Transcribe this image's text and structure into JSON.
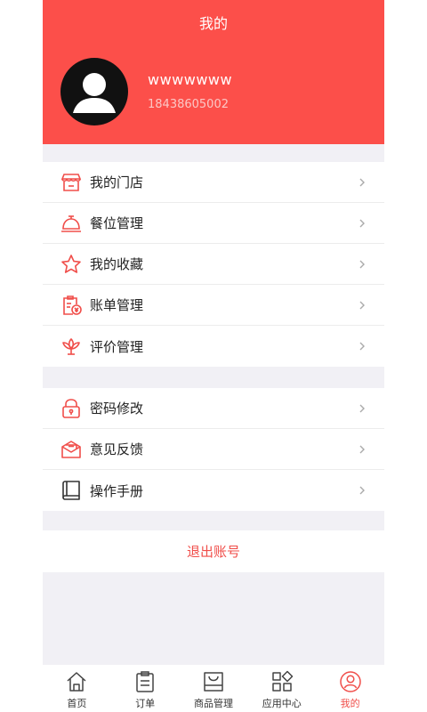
{
  "header": {
    "title": "我的",
    "username": "wwwwwww",
    "phone": "18438605002"
  },
  "group1": [
    {
      "label": "我的门店",
      "icon": "store-icon"
    },
    {
      "label": "餐位管理",
      "icon": "service-bell-icon"
    },
    {
      "label": "我的收藏",
      "icon": "star-icon"
    },
    {
      "label": "账单管理",
      "icon": "bill-icon"
    },
    {
      "label": "评价管理",
      "icon": "lotus-icon"
    }
  ],
  "group2": [
    {
      "label": "密码修改",
      "icon": "lock-icon"
    },
    {
      "label": "意见反馈",
      "icon": "feedback-envelope-icon"
    },
    {
      "label": "操作手册",
      "icon": "book-icon"
    }
  ],
  "logout": "退出账号",
  "tabs": [
    {
      "label": "首页",
      "icon": "home-icon"
    },
    {
      "label": "订单",
      "icon": "clipboard-icon"
    },
    {
      "label": "商品管理",
      "icon": "bag-icon"
    },
    {
      "label": "应用中心",
      "icon": "apps-icon"
    },
    {
      "label": "我的",
      "icon": "user-icon",
      "active": true
    }
  ],
  "colors": {
    "accent": "#fc4f4a",
    "accent_text": "#f04e4a",
    "background": "#f1f0f5"
  }
}
